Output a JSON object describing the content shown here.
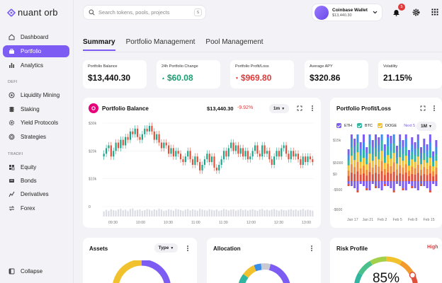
{
  "app": {
    "name": "nuant orb"
  },
  "sidebar": {
    "items": [
      {
        "label": "Dashboard",
        "icon": "home-icon"
      },
      {
        "label": "Portfolio",
        "icon": "briefcase-icon",
        "active": true
      },
      {
        "label": "Analytics",
        "icon": "bar-chart-icon"
      }
    ],
    "defi_label": "DEFI",
    "defi_items": [
      {
        "label": "Liquidity Mining",
        "icon": "coins-icon"
      },
      {
        "label": "Staking",
        "icon": "stack-icon"
      },
      {
        "label": "Yield Protocols",
        "icon": "cog-icon"
      },
      {
        "label": "Strategies",
        "icon": "target-icon"
      }
    ],
    "tradfi_label": "TRADFI",
    "tradfi_items": [
      {
        "label": "Equity",
        "icon": "equity-icon"
      },
      {
        "label": "Bonds",
        "icon": "bonds-icon"
      },
      {
        "label": "Derivatives",
        "icon": "derivatives-icon"
      },
      {
        "label": "Forex",
        "icon": "forex-icon"
      }
    ],
    "collapse_label": "Collapse"
  },
  "header": {
    "search_placeholder": "Search tokens, pools, projects",
    "search_shortcut": "S",
    "wallet_name": "Coinbase Wallet",
    "wallet_balance": "$13,440.30",
    "notification_count": "5"
  },
  "tabs": [
    {
      "label": "Summary",
      "active": true
    },
    {
      "label": "Portfolio Management"
    },
    {
      "label": "Pool Management"
    }
  ],
  "stats": [
    {
      "label": "Portfolio Balance",
      "value": "$13,440.30",
      "tone": "neutral"
    },
    {
      "label": "24h Portfolio Change",
      "value": "$60.08",
      "arrow": "▲",
      "tone": "green"
    },
    {
      "label": "Portfolio Profit/Loss",
      "value": "$969.80",
      "arrow": "▼",
      "tone": "red"
    },
    {
      "label": "Average APY",
      "value": "$320.86",
      "tone": "neutral"
    },
    {
      "label": "Volatility",
      "value": "21.15%",
      "tone": "neutral"
    }
  ],
  "balance_card": {
    "title": "Portfolio Balance",
    "value": "$13,440.30",
    "change": "-9.92%",
    "range": "1m"
  },
  "pl_card": {
    "title": "Portfolio Profit/Loss",
    "legend": [
      "ETH",
      "BTC",
      "DOGE"
    ],
    "next_label": "Next 5",
    "range": "1M"
  },
  "assets_card": {
    "title": "Assets",
    "filter": "Type"
  },
  "allocation_card": {
    "title": "Allocation"
  },
  "risk_card": {
    "title": "Risk Profile",
    "level": "High",
    "value": "85%"
  },
  "colors": {
    "accent": "#7c5cf2",
    "up": "#1aa68a",
    "down": "#e0503a",
    "eth": "#7c5cf2",
    "btc": "#2fb5a0",
    "doge": "#f2c12e"
  },
  "chart_data": [
    {
      "type": "candlestick",
      "title": "Portfolio Balance",
      "x_ticks": [
        "09:30",
        "10:00",
        "10:30",
        "11:00",
        "11:30",
        "12:00",
        "12:30",
        "13:00"
      ],
      "y_ticks": [
        "$30k",
        "$20k",
        "$10k",
        "0"
      ],
      "ylim": [
        0,
        30
      ],
      "closes": [
        19,
        21,
        22,
        18,
        20,
        23,
        21,
        24,
        22,
        25,
        24,
        27,
        26,
        28,
        25,
        24,
        26,
        28,
        27,
        29,
        27,
        24,
        26,
        23,
        21,
        23,
        22,
        19,
        21,
        18,
        20,
        19,
        17,
        16,
        18,
        20,
        17,
        15,
        18,
        16,
        13,
        15,
        17,
        19,
        16,
        18,
        14,
        13,
        15,
        17,
        20,
        18,
        21,
        23,
        20,
        22,
        19,
        21,
        18,
        20,
        17,
        18,
        20,
        22,
        19,
        18,
        22,
        19,
        20,
        17,
        15,
        18,
        20,
        18,
        21,
        22,
        19,
        17,
        20,
        18,
        19,
        17,
        15,
        18,
        16,
        18,
        17,
        16
      ],
      "volume": [
        42,
        55,
        47,
        60,
        52,
        48,
        58,
        63,
        51,
        57,
        45,
        62,
        66,
        50,
        54,
        59,
        47,
        53,
        61,
        56,
        49,
        58,
        52,
        64,
        57,
        46,
        51,
        60,
        55,
        48,
        62,
        58,
        53,
        47,
        56,
        61,
        50,
        59,
        54,
        48,
        63,
        57,
        52,
        49,
        60,
        55,
        51,
        58,
        46,
        53,
        62,
        57,
        50,
        56,
        59,
        48,
        54,
        61,
        52,
        57,
        49,
        55,
        60,
        53,
        47,
        58,
        62,
        51,
        56,
        50,
        57,
        61,
        54,
        48,
        59,
        53,
        50,
        56,
        60,
        52,
        58,
        49,
        55,
        62,
        51,
        57,
        53,
        48
      ]
    },
    {
      "type": "bar",
      "title": "Portfolio Profit/Loss",
      "y_ticks": [
        "$15k",
        "$5000",
        "$0",
        "-$500",
        "-$600"
      ],
      "x_ticks": [
        "Jan 17",
        "Jan 21",
        "Feb 2",
        "Feb 5",
        "Feb 8",
        "Feb 15"
      ],
      "stacked_heights": [
        45,
        72,
        60,
        82,
        55,
        66,
        48,
        78,
        58,
        70,
        62,
        86,
        52,
        74,
        64,
        80,
        50,
        68,
        58,
        72,
        44,
        62,
        55,
        70,
        48,
        60,
        52,
        66,
        42,
        58
      ]
    },
    {
      "type": "pie",
      "title": "Risk Profile",
      "value": 85
    }
  ]
}
